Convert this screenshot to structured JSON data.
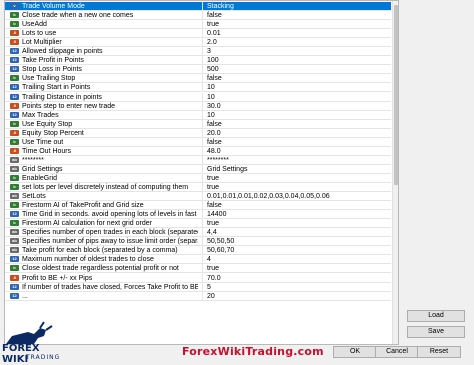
{
  "rows": [
    {
      "name": "Trade Volume Mode",
      "value": "Stacking",
      "icon": "enum-icon"
    },
    {
      "name": "Close trade when a new one comes",
      "value": "false",
      "icon": "bool-icon"
    },
    {
      "name": "UseAdd",
      "value": "true",
      "icon": "bool-icon"
    },
    {
      "name": "Lots to use",
      "value": "0.01",
      "icon": "double-icon"
    },
    {
      "name": "Lot Multiplier",
      "value": "2.0",
      "icon": "double-icon"
    },
    {
      "name": "Allowed slippage in points",
      "value": "3",
      "icon": "int-icon"
    },
    {
      "name": "Take Profit in Points",
      "value": "100",
      "icon": "int-icon"
    },
    {
      "name": "Stop Loss in Points",
      "value": "500",
      "icon": "int-icon"
    },
    {
      "name": "Use Trailing Stop",
      "value": "false",
      "icon": "bool-icon"
    },
    {
      "name": "Trailing Start in Points",
      "value": "10",
      "icon": "int-icon"
    },
    {
      "name": "Trailing Distance in points",
      "value": "10",
      "icon": "int-icon"
    },
    {
      "name": "Points step to enter new trade",
      "value": "30.0",
      "icon": "double-icon"
    },
    {
      "name": "Max Trades",
      "value": "10",
      "icon": "int-icon"
    },
    {
      "name": "Use Equity Stop",
      "value": "false",
      "icon": "bool-icon"
    },
    {
      "name": "Equity Stop Percent",
      "value": "20.0",
      "icon": "double-icon"
    },
    {
      "name": "Use Time out",
      "value": "false",
      "icon": "bool-icon"
    },
    {
      "name": "Time Out Hours",
      "value": "48.0",
      "icon": "double-icon"
    },
    {
      "name": "********",
      "value": "********",
      "icon": "string-icon"
    },
    {
      "name": "Grid Settings",
      "value": "Grid Settings",
      "icon": "string-icon"
    },
    {
      "name": "EnableGrid",
      "value": "true",
      "icon": "bool-icon"
    },
    {
      "name": "set lots per level discretely instead of computing them",
      "value": "true",
      "icon": "bool-icon"
    },
    {
      "name": "SetLots",
      "value": "0.01,0.01,0.01,0.02,0.03,0.04,0.05,0.06",
      "icon": "string-icon"
    },
    {
      "name": "Firestorm AI of TakeProfit and Grid size",
      "value": "false",
      "icon": "bool-icon"
    },
    {
      "name": "Time Grid in seconds. avoid opening lots of levels in fast mark",
      "value": "14400",
      "icon": "int-icon"
    },
    {
      "name": "Firestorm AI calculation for next grid order",
      "value": "true",
      "icon": "bool-icon"
    },
    {
      "name": "Specifies number of open trades in each block (separated by a c",
      "value": "4,4",
      "icon": "string-icon"
    },
    {
      "name": "Specifies number of pips away to issue limit order (separated b",
      "value": "50,50,50",
      "icon": "string-icon"
    },
    {
      "name": "Take profit for each block (separated by a comma)",
      "value": "50,60,70",
      "icon": "string-icon"
    },
    {
      "name": "Maximum number of oldest trades to close",
      "value": "4",
      "icon": "int-icon"
    },
    {
      "name": "Close oldest trade regardless potential profit or not",
      "value": "true",
      "icon": "bool-icon"
    },
    {
      "name": "Profit to BE +/- xx Pips",
      "value": "70.0",
      "icon": "double-icon"
    },
    {
      "name": "If number of trades have closed, Forces Take Profit to BE +/- xx",
      "value": "5",
      "icon": "int-icon"
    },
    {
      "name": "...",
      "value": "20",
      "icon": "int-icon"
    }
  ],
  "buttons": {
    "load": "Load",
    "save": "Save",
    "ok": "OK",
    "cancel": "Cancel",
    "reset": "Reset"
  },
  "watermark": "ForexWikiTrading.com",
  "logo": {
    "brand": "FOREX WIKI",
    "sub": "TRADING"
  }
}
